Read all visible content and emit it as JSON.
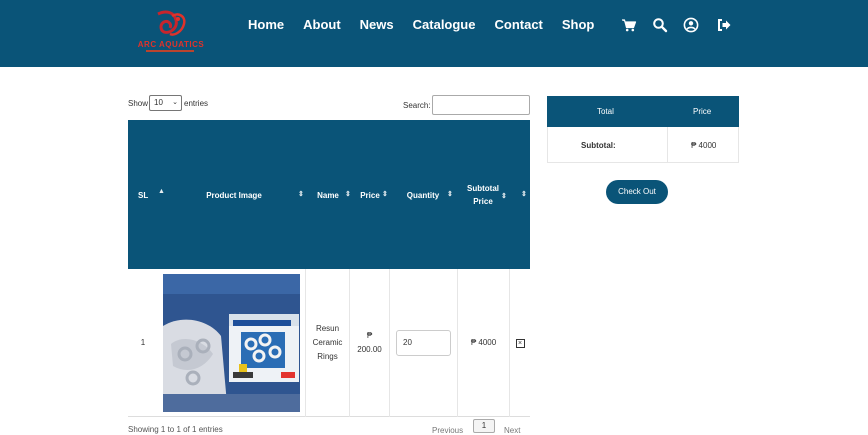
{
  "brand": {
    "name": "ARC AQUATICS",
    "primary_color": "#0a5478",
    "logo_color": "#e0322a"
  },
  "nav": {
    "items": [
      "Home",
      "About",
      "News",
      "Catalogue",
      "Contact",
      "Shop"
    ],
    "icons": [
      "cart-icon",
      "search-icon",
      "user-icon",
      "logout-icon"
    ]
  },
  "table_controls": {
    "show_label": "Show",
    "entries_value": "10",
    "entries_label": "entries",
    "search_label": "Search:",
    "search_value": ""
  },
  "cart_table": {
    "headers": [
      "SL",
      "Product Image",
      "Name",
      "Price",
      "Quantity",
      "Subtotal Price",
      ""
    ],
    "rows": [
      {
        "sl": "1",
        "product_image": "ceramic-rings-box-photo",
        "name": "Resun Ceramic Rings",
        "price_symbol": "₱",
        "price": "200.00",
        "quantity": "20",
        "subtotal": "₱ 4000"
      }
    ],
    "info_text": "Showing 1 to 1 of 1 entries",
    "pagination": {
      "previous": "Previous",
      "current_page": "1",
      "next": "Next"
    }
  },
  "summary": {
    "headers": [
      "Total",
      "Price"
    ],
    "subtotal_label": "Subtotal:",
    "subtotal_value": "₱ 4000",
    "checkout_label": "Check Out"
  }
}
